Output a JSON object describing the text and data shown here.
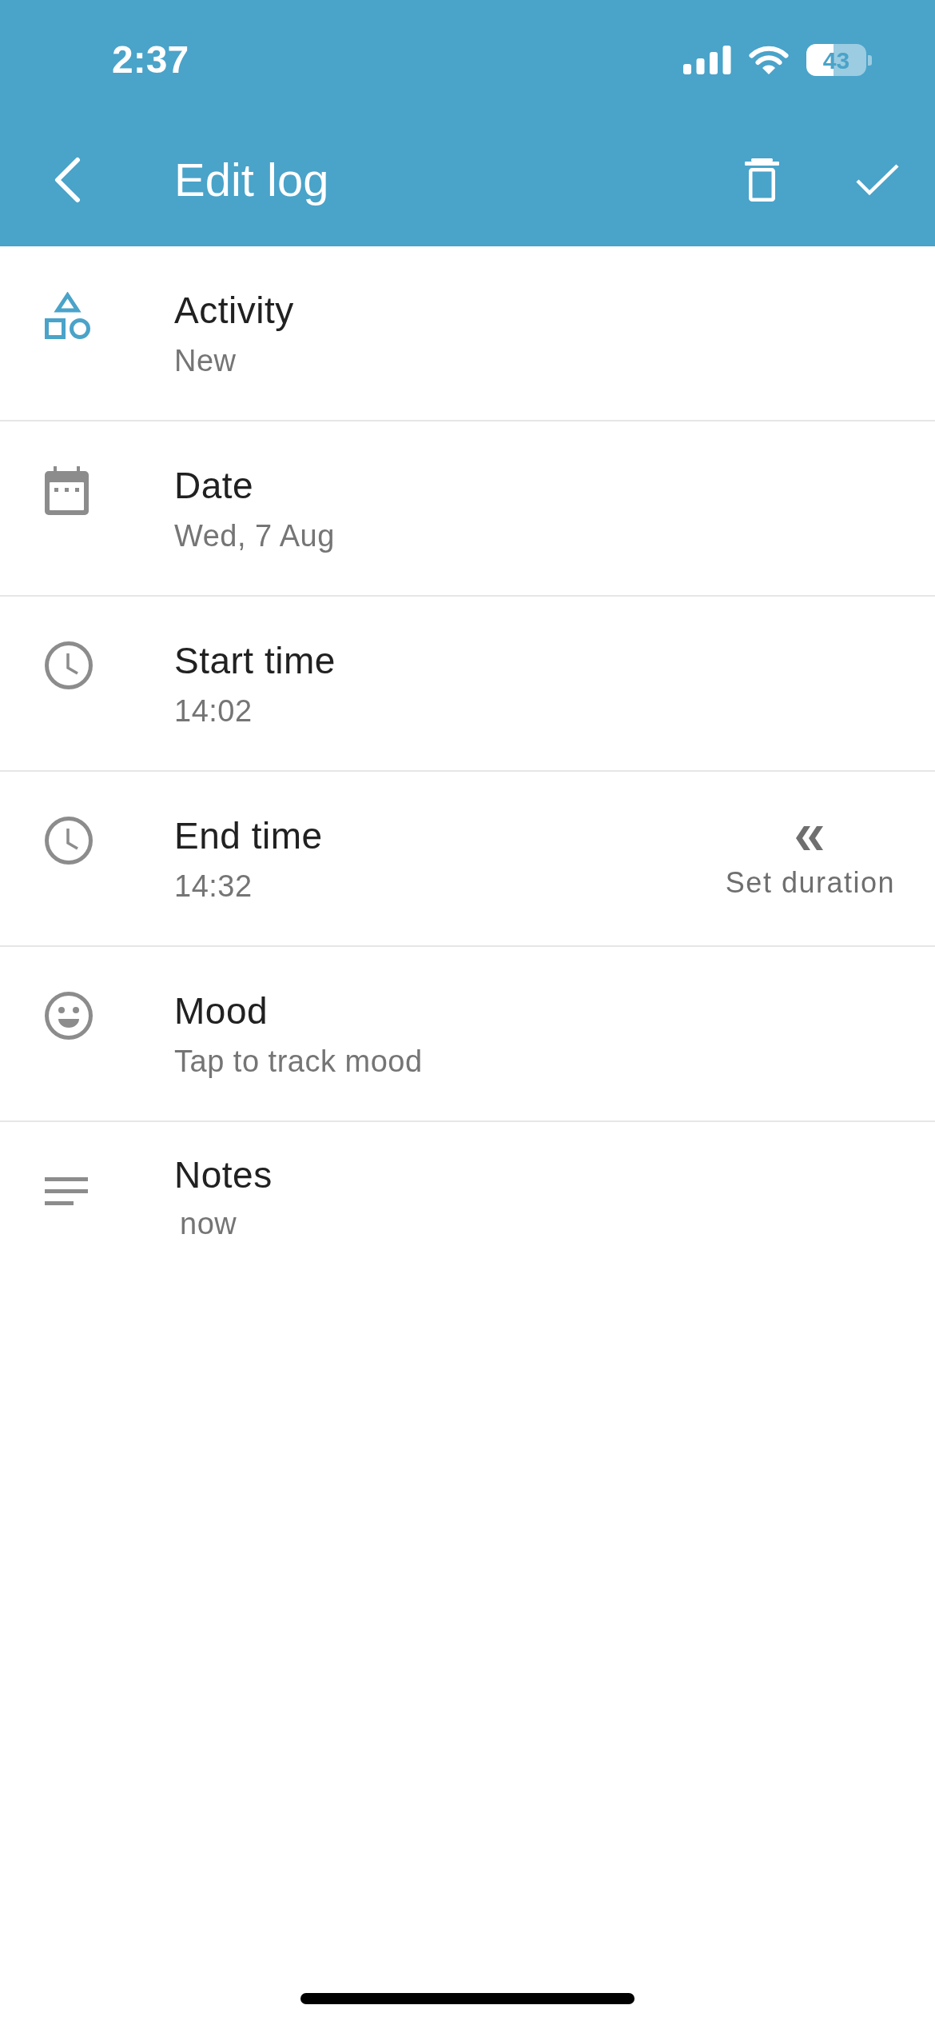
{
  "status_bar": {
    "time": "2:37",
    "battery": "43"
  },
  "app_bar": {
    "title": "Edit log"
  },
  "fields": [
    {
      "kind": "activity",
      "label": "Activity",
      "value": "New"
    },
    {
      "kind": "date",
      "label": "Date",
      "value": "Wed, 7 Aug"
    },
    {
      "kind": "time",
      "label": "Start time",
      "value": "14:02"
    },
    {
      "kind": "time",
      "label": "End time",
      "value": "14:32",
      "action": {
        "label": "Set duration"
      }
    },
    {
      "kind": "mood",
      "label": "Mood",
      "value": "Tap to track mood"
    },
    {
      "kind": "notes",
      "label": "Notes",
      "value": "now"
    }
  ]
}
